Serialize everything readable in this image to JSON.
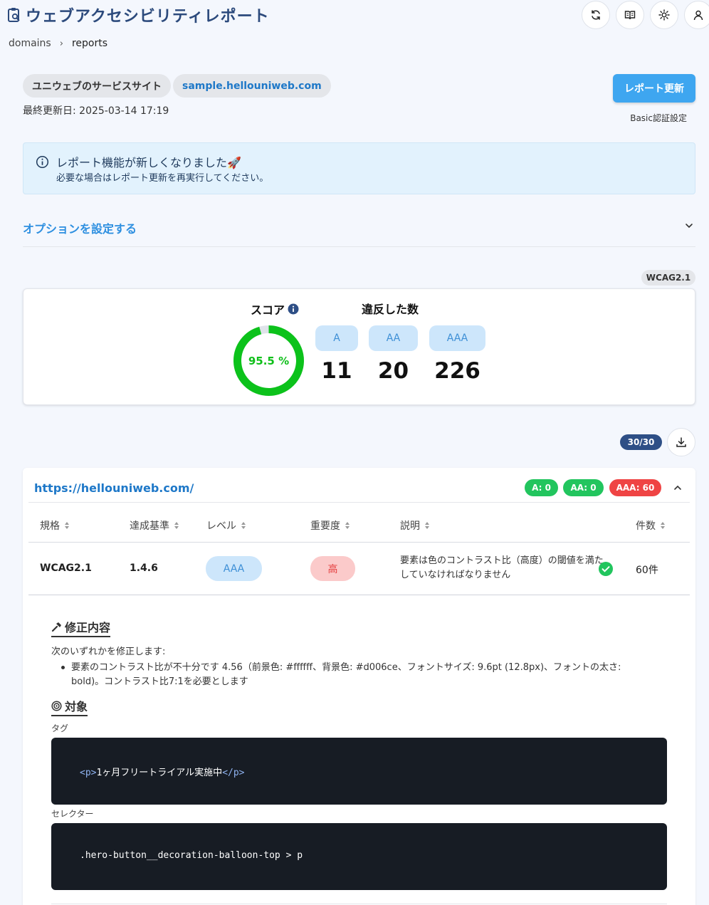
{
  "header": {
    "title": "ウェブアクセシビリティレポート",
    "icons": {
      "logo": "clipboard-search-icon",
      "refresh": "refresh-icon",
      "docs": "book-icon",
      "theme": "sun-icon",
      "user": "user-icon"
    }
  },
  "breadcrumb": {
    "items": [
      "domains",
      "reports"
    ]
  },
  "site": {
    "name": "ユニウェブのサービスサイト",
    "domain": "sample.hellouniweb.com",
    "last_updated": "最終更新日: 2025-03-14 17:19",
    "refresh_label": "レポート更新",
    "basic_auth_label": "Basic認証設定"
  },
  "alert": {
    "title": "レポート機能が新しくなりました🚀",
    "body": "必要な場合はレポート更新を再実行してください。"
  },
  "options": {
    "label": "オプションを設定する"
  },
  "standard_tag": "WCAG2.1",
  "score": {
    "label": "スコア",
    "value": 95.5,
    "display": "95.5 %",
    "violations_label": "違反した数",
    "levels": [
      {
        "label": "A",
        "count": "11"
      },
      {
        "label": "AA",
        "count": "20"
      },
      {
        "label": "AAA",
        "count": "226"
      }
    ]
  },
  "pager": "30/30",
  "page_result": {
    "url": "https://hellouniweb.com/",
    "badges": [
      {
        "label": "A: 0",
        "color": "#22c55e"
      },
      {
        "label": "AA: 0",
        "color": "#22c55e"
      },
      {
        "label": "AAA: 60",
        "color": "#ef4444"
      }
    ],
    "columns": [
      "規格",
      "達成基準",
      "レベル",
      "重要度",
      "説明",
      "件数"
    ],
    "row": {
      "standard": "WCAG2.1",
      "criterion": "1.4.6",
      "level": "AAA",
      "severity": "高",
      "description": "要素は色のコントラスト比（高度）の閾値を満たしていなければなりません",
      "count": "60件"
    },
    "fix": {
      "title": "修正内容",
      "intro": "次のいずれかを修正します:",
      "bullet": "要素のコントラスト比が不十分です 4.56（前景色: #ffffff、背景色: #d006ce、フォントサイズ: 9.6pt (12.8px)、フォントの太さ: bold)。コントラスト比7:1を必要とします"
    },
    "target": {
      "title": "対象",
      "tag_label": "タグ",
      "tag_open": "<p>",
      "tag_text": "1ヶ月フリートライアル実施中",
      "tag_close": "</p>",
      "selector_label": "セレクター",
      "selector": ".hero-button__decoration-balloon-top > p"
    }
  }
}
